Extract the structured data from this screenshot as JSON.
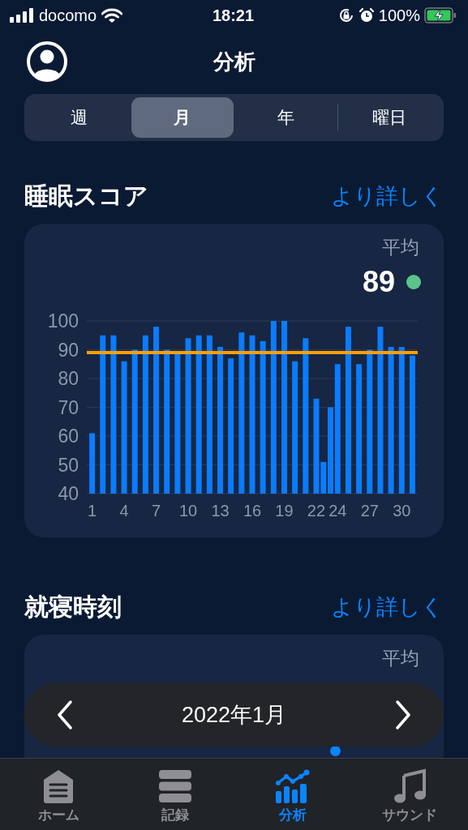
{
  "status_bar": {
    "carrier": "docomo",
    "time": "18:21",
    "battery": "100%"
  },
  "header": {
    "title": "分析"
  },
  "tabs": [
    {
      "label": "週",
      "selected": false
    },
    {
      "label": "月",
      "selected": true
    },
    {
      "label": "年",
      "selected": false
    },
    {
      "label": "曜日",
      "selected": false
    }
  ],
  "sections": [
    {
      "title": "睡眠スコア",
      "link": "より詳しく",
      "average_label": "平均",
      "average_value": "89",
      "chart_data": {
        "type": "bar",
        "x": [
          1,
          2,
          3,
          4,
          5,
          6,
          7,
          8,
          9,
          10,
          11,
          12,
          13,
          14,
          15,
          16,
          17,
          18,
          19,
          20,
          21,
          22,
          22.67,
          23.33,
          24,
          25,
          26,
          27,
          28,
          29,
          30,
          31
        ],
        "xlim": [
          0.5,
          31.5
        ],
        "grid": true,
        "series": [
          {
            "color": "#0a7cff",
            "values": [
              61,
              95,
              95,
              86,
              90,
              95,
              98,
              90,
              89,
              94,
              95,
              95,
              91,
              87,
              96,
              95,
              93,
              100,
              100,
              86,
              94,
              73,
              51,
              70,
              85,
              98,
              85,
              90,
              98,
              91,
              91,
              88
            ]
          }
        ],
        "ylim": [
          40,
          100
        ],
        "yticks": [
          40,
          50,
          60,
          70,
          80,
          90,
          100
        ],
        "xticks": [
          {
            "value": 1,
            "label": "1"
          },
          {
            "value": 4,
            "label": "4"
          },
          {
            "value": 7,
            "label": "7"
          },
          {
            "value": 10,
            "label": "10"
          },
          {
            "value": 13,
            "label": "13"
          },
          {
            "value": 16,
            "label": "16"
          },
          {
            "value": 19,
            "label": "19"
          },
          {
            "value": 22,
            "label": "22"
          },
          {
            "value": 24,
            "label": "24"
          },
          {
            "value": 27,
            "label": "27"
          },
          {
            "value": 30,
            "label": "30"
          }
        ],
        "ref_lines": [
          {
            "axis": "y",
            "value": 89,
            "color": "#ff9f0a"
          }
        ]
      }
    },
    {
      "title": "就寝時刻",
      "link": "より詳しく",
      "average_label": "平均"
    }
  ],
  "period_picker": {
    "label": "2022年1月"
  },
  "tab_bar": [
    {
      "kind": "home",
      "label": "ホーム",
      "selected": false
    },
    {
      "kind": "list",
      "label": "記録",
      "selected": false
    },
    {
      "kind": "chart",
      "label": "分析",
      "selected": true
    },
    {
      "kind": "music",
      "label": "サウンド",
      "selected": false
    }
  ]
}
